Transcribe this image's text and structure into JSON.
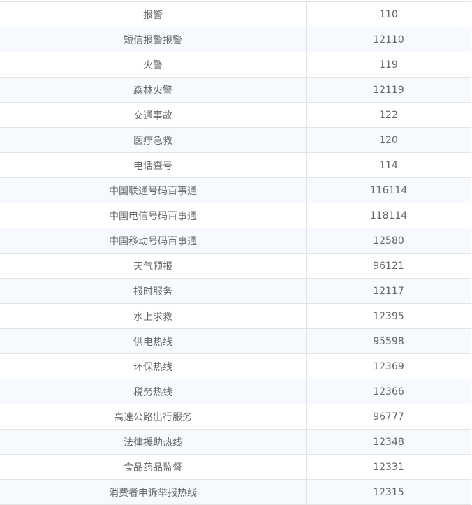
{
  "rows": [
    {
      "name": "报警",
      "number": "110"
    },
    {
      "name": "短信报警报警",
      "number": "12110"
    },
    {
      "name": "火警",
      "number": "119"
    },
    {
      "name": "森林火警",
      "number": "12119"
    },
    {
      "name": "交通事故",
      "number": "122"
    },
    {
      "name": "医疗急救",
      "number": "120"
    },
    {
      "name": "电话查号",
      "number": "114"
    },
    {
      "name": "中国联通号码百事通",
      "number": "116114"
    },
    {
      "name": "中国电信号码百事通",
      "number": "118114"
    },
    {
      "name": "中国移动号码百事通",
      "number": "12580"
    },
    {
      "name": "天气预报",
      "number": "96121"
    },
    {
      "name": "报时服务",
      "number": "12117"
    },
    {
      "name": "水上求救",
      "number": "12395"
    },
    {
      "name": "供电热线",
      "number": "95598"
    },
    {
      "name": "环保热线",
      "number": "12369"
    },
    {
      "name": "税务热线",
      "number": "12366"
    },
    {
      "name": "高速公路出行服务",
      "number": "96777"
    },
    {
      "name": "法律援助热线",
      "number": "12348"
    },
    {
      "name": "食品药品监督",
      "number": "12331"
    },
    {
      "name": "消费者申诉举报热线",
      "number": "12315"
    }
  ]
}
